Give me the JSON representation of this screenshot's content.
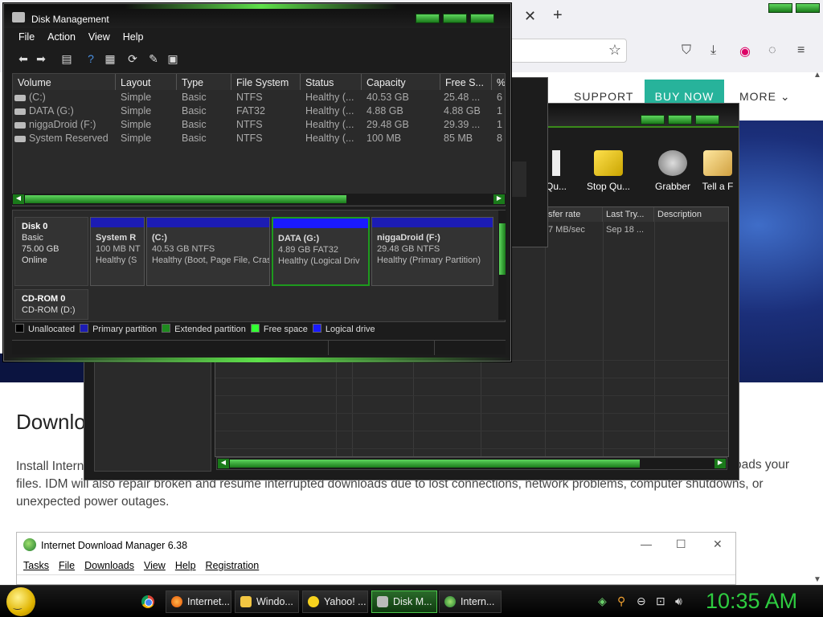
{
  "browser": {
    "nav": {
      "support": "SUPPORT",
      "buy_now": "BUY NOW",
      "more": "MORE"
    },
    "heading": "Downlo",
    "paragraph_line1": "Install Intern",
    "paragraph_right": "oads your",
    "paragraph_line2": "files. IDM will also repair broken and resume interrupted downloads due to lost connections, network problems, computer shutdowns, or",
    "paragraph_line3": "unexpected power outages."
  },
  "idm_white": {
    "title": "Internet Download Manager 6.38",
    "menu": [
      "Tasks",
      "File",
      "Downloads",
      "View",
      "Help",
      "Registration"
    ]
  },
  "idm_dark": {
    "tools": [
      "Qu...",
      "Stop Qu...",
      "Grabber",
      "Tell a F"
    ],
    "columns": [
      "sfer rate",
      "Last Try...",
      "Description"
    ],
    "row": {
      "rate": "7 MB/sec",
      "last_try": "Sep 18 ..."
    }
  },
  "disk_mgmt": {
    "title": "Disk Management",
    "menu": [
      "File",
      "Action",
      "View",
      "Help"
    ],
    "columns": [
      "Volume",
      "Layout",
      "Type",
      "File System",
      "Status",
      "Capacity",
      "Free S...",
      "%"
    ],
    "volumes": [
      {
        "volume": "(C:)",
        "layout": "Simple",
        "type": "Basic",
        "fs": "NTFS",
        "status": "Healthy (...",
        "capacity": "40.53 GB",
        "free": "25.48 ...",
        "pct": "6"
      },
      {
        "volume": "DATA (G:)",
        "layout": "Simple",
        "type": "Basic",
        "fs": "FAT32",
        "status": "Healthy (...",
        "capacity": "4.88 GB",
        "free": "4.88 GB",
        "pct": "1"
      },
      {
        "volume": "niggaDroid (F:)",
        "layout": "Simple",
        "type": "Basic",
        "fs": "NTFS",
        "status": "Healthy (...",
        "capacity": "29.48 GB",
        "free": "29.39 ...",
        "pct": "1"
      },
      {
        "volume": "System Reserved",
        "layout": "Simple",
        "type": "Basic",
        "fs": "NTFS",
        "status": "Healthy (...",
        "capacity": "100 MB",
        "free": "85 MB",
        "pct": "8"
      }
    ],
    "disk0": {
      "name": "Disk 0",
      "type": "Basic",
      "size": "75.00 GB",
      "state": "Online"
    },
    "partitions": [
      {
        "name": "System R",
        "size": "100 MB NT",
        "status": "Healthy (S"
      },
      {
        "name": "(C:)",
        "size": "40.53 GB NTFS",
        "status": "Healthy (Boot, Page File, Cras"
      },
      {
        "name": "DATA  (G:)",
        "size": "4.89 GB FAT32",
        "status": "Healthy (Logical Driv"
      },
      {
        "name": "niggaDroid  (F:)",
        "size": "29.48 GB NTFS",
        "status": "Healthy (Primary Partition)"
      }
    ],
    "cdrom": {
      "name": "CD-ROM 0",
      "sub": "CD-ROM (D:)"
    },
    "legend": [
      {
        "label": "Unallocated",
        "color": "#000000"
      },
      {
        "label": "Primary partition",
        "color": "#1c1cb4"
      },
      {
        "label": "Extended partition",
        "color": "#1e8a1e"
      },
      {
        "label": "Free space",
        "color": "#33ff33"
      },
      {
        "label": "Logical drive",
        "color": "#1a1aff"
      }
    ]
  },
  "taskbar": {
    "buttons": [
      "Internet...",
      "Windo...",
      "Yahoo! ...",
      "Disk M...",
      "Intern..."
    ],
    "clock": "10:35 AM"
  }
}
